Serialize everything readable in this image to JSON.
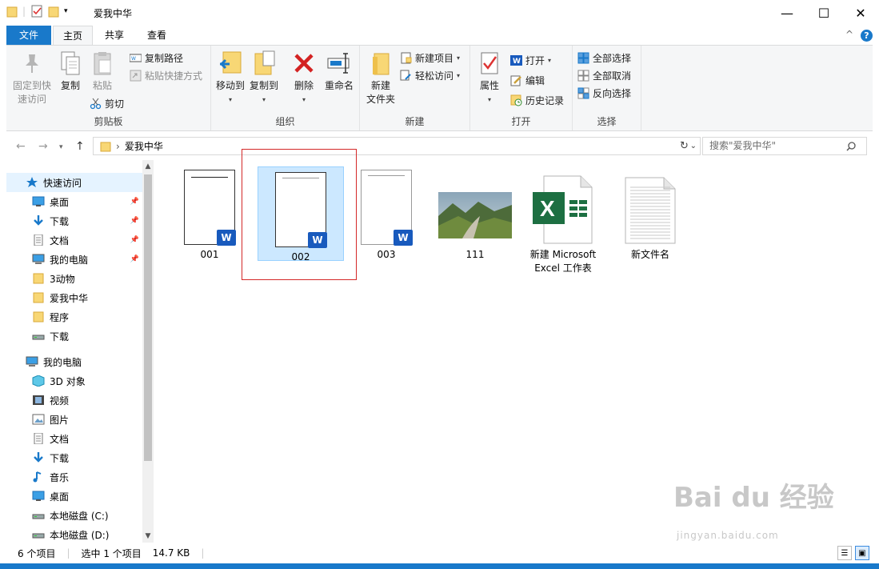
{
  "window": {
    "title": "爱我中华",
    "minimize": "—",
    "maximize": "☐",
    "close": "✕"
  },
  "tabs": {
    "file": "文件",
    "home": "主页",
    "share": "共享",
    "view": "查看",
    "collapse": "^",
    "help": "?"
  },
  "ribbon": {
    "clipboard": {
      "label": "剪贴板",
      "pin": "固定到快\n速访问",
      "copy": "复制",
      "paste": "粘贴",
      "copy_path": "复制路径",
      "paste_shortcut": "粘贴快捷方式",
      "cut": "剪切"
    },
    "organize": {
      "label": "组织",
      "move_to": "移动到",
      "copy_to": "复制到",
      "delete": "删除",
      "rename": "重命名"
    },
    "new": {
      "label": "新建",
      "new_folder": "新建\n文件夹",
      "new_item": "新建项目",
      "easy_access": "轻松访问"
    },
    "open": {
      "label": "打开",
      "properties": "属性",
      "open": "打开",
      "edit": "编辑",
      "history": "历史记录"
    },
    "select": {
      "label": "选择",
      "select_all": "全部选择",
      "select_none": "全部取消",
      "invert": "反向选择"
    }
  },
  "address": {
    "path": "爱我中华",
    "search_placeholder": "搜索\"爱我中华\"",
    "separator": "›"
  },
  "nav": [
    {
      "label": "快速访问",
      "icon": "star-icon",
      "pinned": false
    },
    {
      "label": "桌面",
      "icon": "desktop-icon",
      "pinned": true
    },
    {
      "label": "下载",
      "icon": "download-icon",
      "pinned": true
    },
    {
      "label": "文档",
      "icon": "document-icon",
      "pinned": true
    },
    {
      "label": "我的电脑",
      "icon": "computer-icon",
      "pinned": true
    },
    {
      "label": "3动物",
      "icon": "folder-icon",
      "pinned": false
    },
    {
      "label": "爱我中华",
      "icon": "folder-icon",
      "pinned": false
    },
    {
      "label": "程序",
      "icon": "folder-icon",
      "pinned": false
    },
    {
      "label": "下载",
      "icon": "drive-icon",
      "pinned": false
    },
    {
      "label": "我的电脑",
      "icon": "computer-icon",
      "pinned": false
    },
    {
      "label": "3D 对象",
      "icon": "cube-icon",
      "pinned": false
    },
    {
      "label": "视频",
      "icon": "video-icon",
      "pinned": false
    },
    {
      "label": "图片",
      "icon": "picture-icon",
      "pinned": false
    },
    {
      "label": "文档",
      "icon": "document-icon",
      "pinned": false
    },
    {
      "label": "下载",
      "icon": "download-icon",
      "pinned": false
    },
    {
      "label": "音乐",
      "icon": "music-icon",
      "pinned": false
    },
    {
      "label": "桌面",
      "icon": "desktop-icon",
      "pinned": false
    },
    {
      "label": "本地磁盘 (C:)",
      "icon": "drive-icon",
      "pinned": false
    },
    {
      "label": "本地磁盘 (D:)",
      "icon": "drive-icon",
      "pinned": false
    }
  ],
  "files": [
    {
      "name": "001",
      "type": "word"
    },
    {
      "name": "002",
      "type": "word",
      "selected": true
    },
    {
      "name": "003",
      "type": "word"
    },
    {
      "name": "111",
      "type": "image"
    },
    {
      "name": "新建 Microsoft\nExcel 工作表",
      "type": "excel"
    },
    {
      "name": "新文件名",
      "type": "text"
    }
  ],
  "status": {
    "count": "6 个项目",
    "selected": "选中 1 个项目",
    "size": "14.7 KB"
  },
  "watermark": {
    "brand": "Bai du 经验",
    "url": "jingyan.baidu.com"
  },
  "colors": {
    "accent": "#1979ca",
    "selection": "#cce8ff",
    "highlight_box": "#d42828",
    "word": "#185abd",
    "excel": "#1d6f42"
  }
}
